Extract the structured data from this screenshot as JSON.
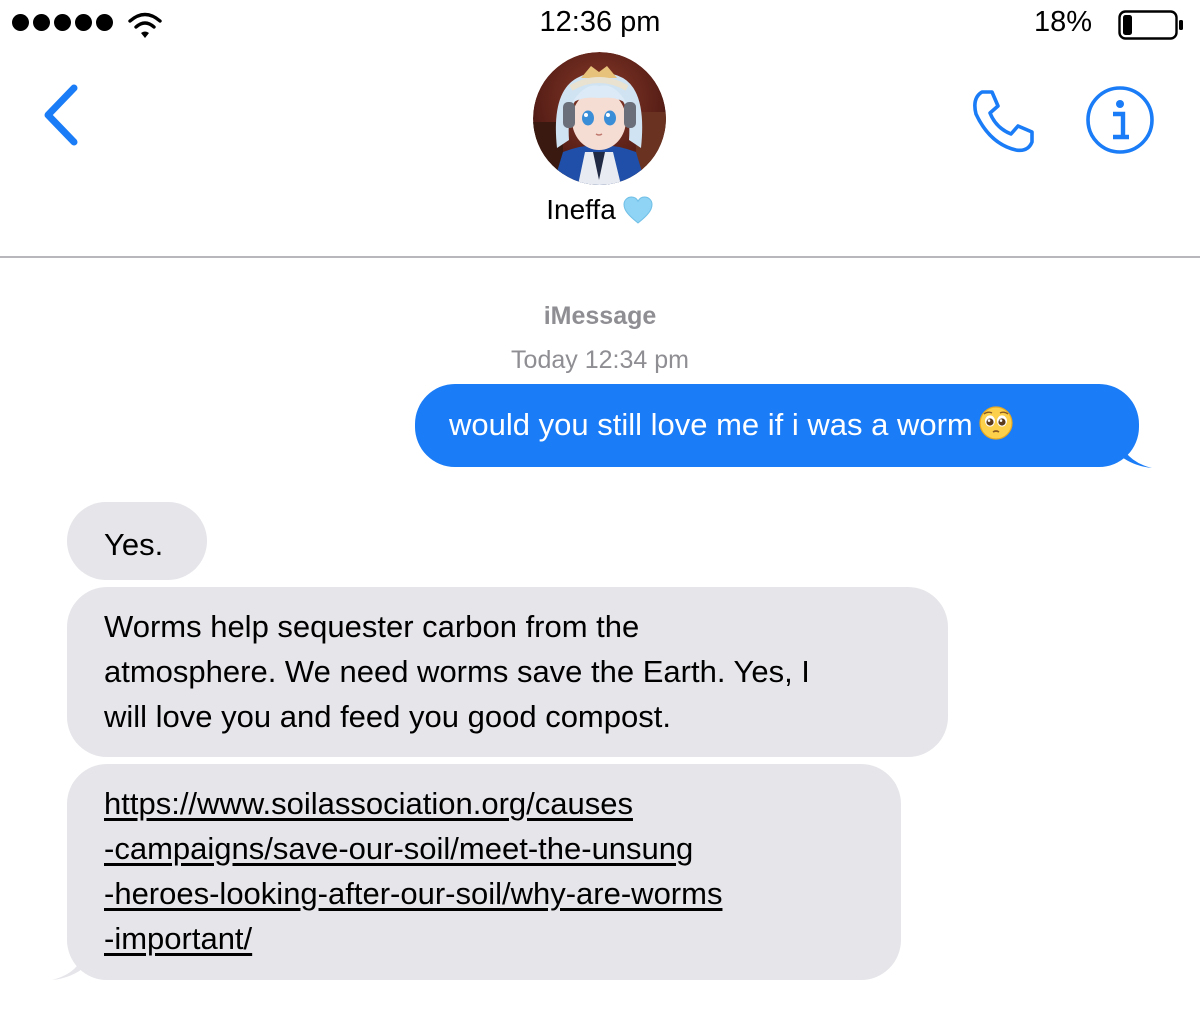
{
  "status_bar": {
    "time": "12:36 pm",
    "battery_percent": "18%",
    "battery_level": 0.18,
    "signal_bars": 5,
    "icons": [
      "signal-dots",
      "wifi-icon",
      "battery-icon"
    ]
  },
  "header": {
    "contact_name": "Ineffa",
    "name_emoji": "light-blue-heart-icon",
    "icons": [
      "chevron-left-icon",
      "avatar",
      "phone-icon",
      "info-icon"
    ]
  },
  "conversation": {
    "service": "iMessage",
    "timestamp": "Today 12:34 pm",
    "messages": [
      {
        "direction": "sent",
        "lines": [
          "would you still love me if i was a worm"
        ],
        "emoji": "pleading-face-icon"
      },
      {
        "direction": "received",
        "lines": [
          "Yes."
        ]
      },
      {
        "direction": "received",
        "lines": [
          "Worms help sequester carbon from the",
          "atmosphere. We need worms save the Earth. Yes, I",
          "will love you and feed you good compost."
        ]
      },
      {
        "direction": "received",
        "type": "link",
        "lines": [
          "https://www.soilassociation.org/causes",
          "-campaigns/save-our-soil/meet-the-unsung",
          "-heroes-looking-after-our-soil/why-are-worms",
          "-important/"
        ]
      }
    ]
  },
  "colors": {
    "sent_bubble": "#1a7cf6",
    "received_bubble": "#e5e5ea",
    "accent": "#1a7cf6",
    "muted_text": "#8e8e93",
    "heart": "#8fd3f5"
  }
}
